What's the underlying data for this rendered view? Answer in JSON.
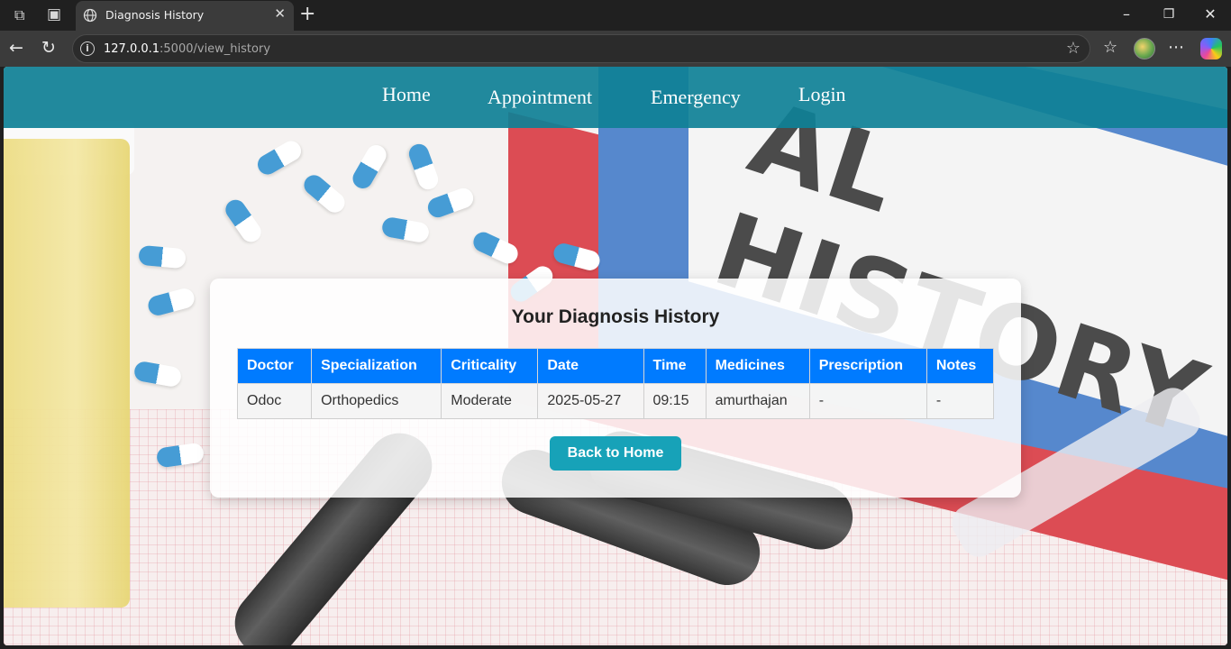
{
  "browser": {
    "tab_title": "Diagnosis History",
    "url_host": "127.0.0.1",
    "url_path": ":5000/view_history"
  },
  "nav": {
    "links": [
      "Home",
      "Appointment",
      "Emergency",
      "Login"
    ]
  },
  "history": {
    "title": "Your Diagnosis History",
    "columns": [
      "Doctor",
      "Specialization",
      "Criticality",
      "Date",
      "Time",
      "Medicines",
      "Prescription",
      "Notes"
    ],
    "rows": [
      [
        "Odoc",
        "Orthopedics",
        "Moderate",
        "2025-05-27",
        "09:15",
        "amurthajan",
        "-",
        "-"
      ]
    ],
    "back_button": "Back to Home"
  },
  "colors": {
    "navbar": "#0e8096",
    "table_header": "#007bff",
    "button": "#17a2b8"
  }
}
